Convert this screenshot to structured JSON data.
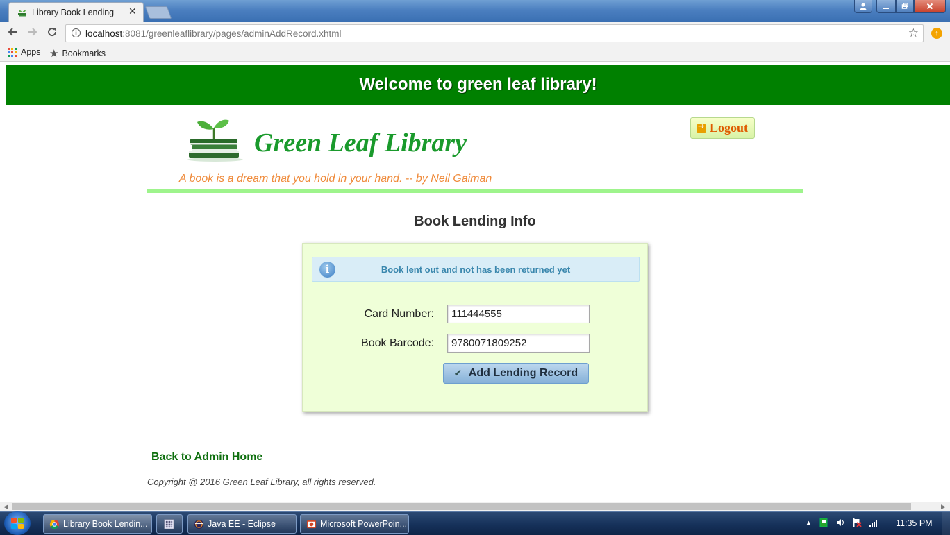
{
  "browser": {
    "tab_title": "Library Book Lending",
    "tab_close": "✕",
    "url_host": "localhost",
    "url_rest": ":8081/greenleaflibrary/pages/adminAddRecord.xhtml",
    "bookmarks": {
      "apps_label": "Apps",
      "bookmarks_label": "Bookmarks"
    }
  },
  "page": {
    "banner": "Welcome to green leaf library!",
    "logo_text": "Green Leaf Library",
    "logout_label": "Logout",
    "quote": "A book is a dream that you hold in your hand. -- by Neil Gaiman",
    "heading": "Book Lending Info",
    "message": "Book lent out and not has been returned yet",
    "form": {
      "card_label": "Card Number:",
      "card_value": "111444555",
      "barcode_label": "Book Barcode:",
      "barcode_value": "9780071809252",
      "submit_label": "Add Lending Record"
    },
    "back_link": "Back to Admin Home",
    "copyright": "Copyright @ 2016 Green Leaf Library, all rights reserved."
  },
  "taskbar": {
    "items": [
      "Library Book Lendin...",
      "Java EE - Eclipse",
      "Microsoft PowerPoin..."
    ],
    "clock": "11:35 PM"
  },
  "colors": {
    "banner_green": "#008000",
    "logo_green": "#1a9a2c",
    "quote_orange": "#ef8a3a",
    "rule_green": "#9ef48c",
    "panel_bg": "#efffd8",
    "info_blue": "#3a87ad"
  },
  "icons": [
    "tab-favicon-icon",
    "back-icon",
    "forward-icon",
    "reload-icon",
    "info-icon",
    "star-icon",
    "extension-icon",
    "apps-icon",
    "bookmark-star-icon",
    "logo-books-icon",
    "logout-icon",
    "info-message-icon",
    "check-icon",
    "windows-start-icon",
    "chrome-icon",
    "eclipse-icon",
    "powerpoint-icon"
  ]
}
